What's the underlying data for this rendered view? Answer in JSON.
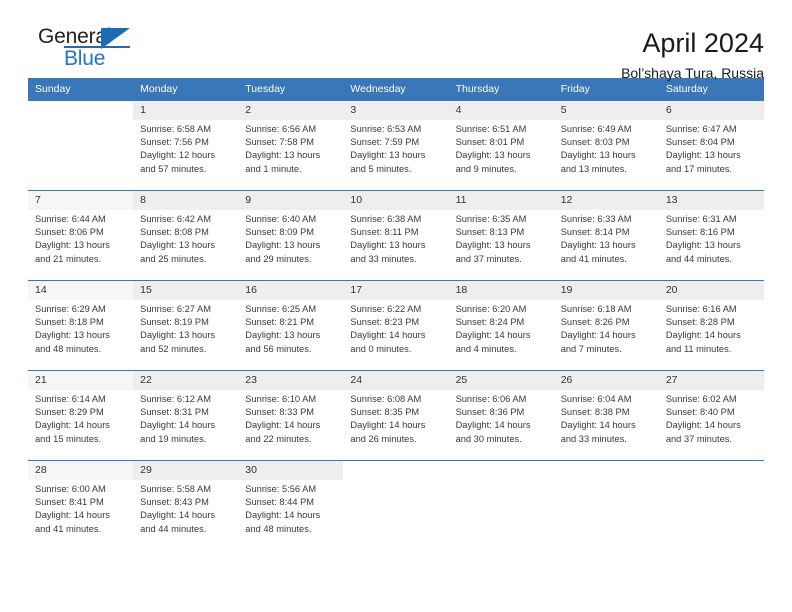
{
  "brand": {
    "name_part1": "General",
    "name_part2": "Blue",
    "logo_icon": "triangle-flag-icon",
    "accent_color": "#2076c9"
  },
  "header": {
    "title": "April 2024",
    "subtitle": "Bol’shaya Tura, Russia"
  },
  "theme": {
    "header_bg": "#3a77b8",
    "header_text": "#ffffff",
    "grid_line": "#3a77b8",
    "cell_shade_a": "#eeeeee",
    "cell_shade_b": "#f6f6f6"
  },
  "calendar": {
    "month": "April",
    "year": "2024",
    "weekday_headers": [
      "Sunday",
      "Monday",
      "Tuesday",
      "Wednesday",
      "Thursday",
      "Friday",
      "Saturday"
    ],
    "weeks": [
      [
        {
          "day": "",
          "info": ""
        },
        {
          "day": "1",
          "info": "Sunrise: 6:58 AM\nSunset: 7:56 PM\nDaylight: 12 hours\nand 57 minutes."
        },
        {
          "day": "2",
          "info": "Sunrise: 6:56 AM\nSunset: 7:58 PM\nDaylight: 13 hours\nand 1 minute."
        },
        {
          "day": "3",
          "info": "Sunrise: 6:53 AM\nSunset: 7:59 PM\nDaylight: 13 hours\nand 5 minutes."
        },
        {
          "day": "4",
          "info": "Sunrise: 6:51 AM\nSunset: 8:01 PM\nDaylight: 13 hours\nand 9 minutes."
        },
        {
          "day": "5",
          "info": "Sunrise: 6:49 AM\nSunset: 8:03 PM\nDaylight: 13 hours\nand 13 minutes."
        },
        {
          "day": "6",
          "info": "Sunrise: 6:47 AM\nSunset: 8:04 PM\nDaylight: 13 hours\nand 17 minutes."
        }
      ],
      [
        {
          "day": "7",
          "info": "Sunrise: 6:44 AM\nSunset: 8:06 PM\nDaylight: 13 hours\nand 21 minutes."
        },
        {
          "day": "8",
          "info": "Sunrise: 6:42 AM\nSunset: 8:08 PM\nDaylight: 13 hours\nand 25 minutes."
        },
        {
          "day": "9",
          "info": "Sunrise: 6:40 AM\nSunset: 8:09 PM\nDaylight: 13 hours\nand 29 minutes."
        },
        {
          "day": "10",
          "info": "Sunrise: 6:38 AM\nSunset: 8:11 PM\nDaylight: 13 hours\nand 33 minutes."
        },
        {
          "day": "11",
          "info": "Sunrise: 6:35 AM\nSunset: 8:13 PM\nDaylight: 13 hours\nand 37 minutes."
        },
        {
          "day": "12",
          "info": "Sunrise: 6:33 AM\nSunset: 8:14 PM\nDaylight: 13 hours\nand 41 minutes."
        },
        {
          "day": "13",
          "info": "Sunrise: 6:31 AM\nSunset: 8:16 PM\nDaylight: 13 hours\nand 44 minutes."
        }
      ],
      [
        {
          "day": "14",
          "info": "Sunrise: 6:29 AM\nSunset: 8:18 PM\nDaylight: 13 hours\nand 48 minutes."
        },
        {
          "day": "15",
          "info": "Sunrise: 6:27 AM\nSunset: 8:19 PM\nDaylight: 13 hours\nand 52 minutes."
        },
        {
          "day": "16",
          "info": "Sunrise: 6:25 AM\nSunset: 8:21 PM\nDaylight: 13 hours\nand 56 minutes."
        },
        {
          "day": "17",
          "info": "Sunrise: 6:22 AM\nSunset: 8:23 PM\nDaylight: 14 hours\nand 0 minutes."
        },
        {
          "day": "18",
          "info": "Sunrise: 6:20 AM\nSunset: 8:24 PM\nDaylight: 14 hours\nand 4 minutes."
        },
        {
          "day": "19",
          "info": "Sunrise: 6:18 AM\nSunset: 8:26 PM\nDaylight: 14 hours\nand 7 minutes."
        },
        {
          "day": "20",
          "info": "Sunrise: 6:16 AM\nSunset: 8:28 PM\nDaylight: 14 hours\nand 11 minutes."
        }
      ],
      [
        {
          "day": "21",
          "info": "Sunrise: 6:14 AM\nSunset: 8:29 PM\nDaylight: 14 hours\nand 15 minutes."
        },
        {
          "day": "22",
          "info": "Sunrise: 6:12 AM\nSunset: 8:31 PM\nDaylight: 14 hours\nand 19 minutes."
        },
        {
          "day": "23",
          "info": "Sunrise: 6:10 AM\nSunset: 8:33 PM\nDaylight: 14 hours\nand 22 minutes."
        },
        {
          "day": "24",
          "info": "Sunrise: 6:08 AM\nSunset: 8:35 PM\nDaylight: 14 hours\nand 26 minutes."
        },
        {
          "day": "25",
          "info": "Sunrise: 6:06 AM\nSunset: 8:36 PM\nDaylight: 14 hours\nand 30 minutes."
        },
        {
          "day": "26",
          "info": "Sunrise: 6:04 AM\nSunset: 8:38 PM\nDaylight: 14 hours\nand 33 minutes."
        },
        {
          "day": "27",
          "info": "Sunrise: 6:02 AM\nSunset: 8:40 PM\nDaylight: 14 hours\nand 37 minutes."
        }
      ],
      [
        {
          "day": "28",
          "info": "Sunrise: 6:00 AM\nSunset: 8:41 PM\nDaylight: 14 hours\nand 41 minutes."
        },
        {
          "day": "29",
          "info": "Sunrise: 5:58 AM\nSunset: 8:43 PM\nDaylight: 14 hours\nand 44 minutes."
        },
        {
          "day": "30",
          "info": "Sunrise: 5:56 AM\nSunset: 8:44 PM\nDaylight: 14 hours\nand 48 minutes."
        },
        {
          "day": "",
          "info": ""
        },
        {
          "day": "",
          "info": ""
        },
        {
          "day": "",
          "info": ""
        },
        {
          "day": "",
          "info": ""
        }
      ]
    ]
  }
}
